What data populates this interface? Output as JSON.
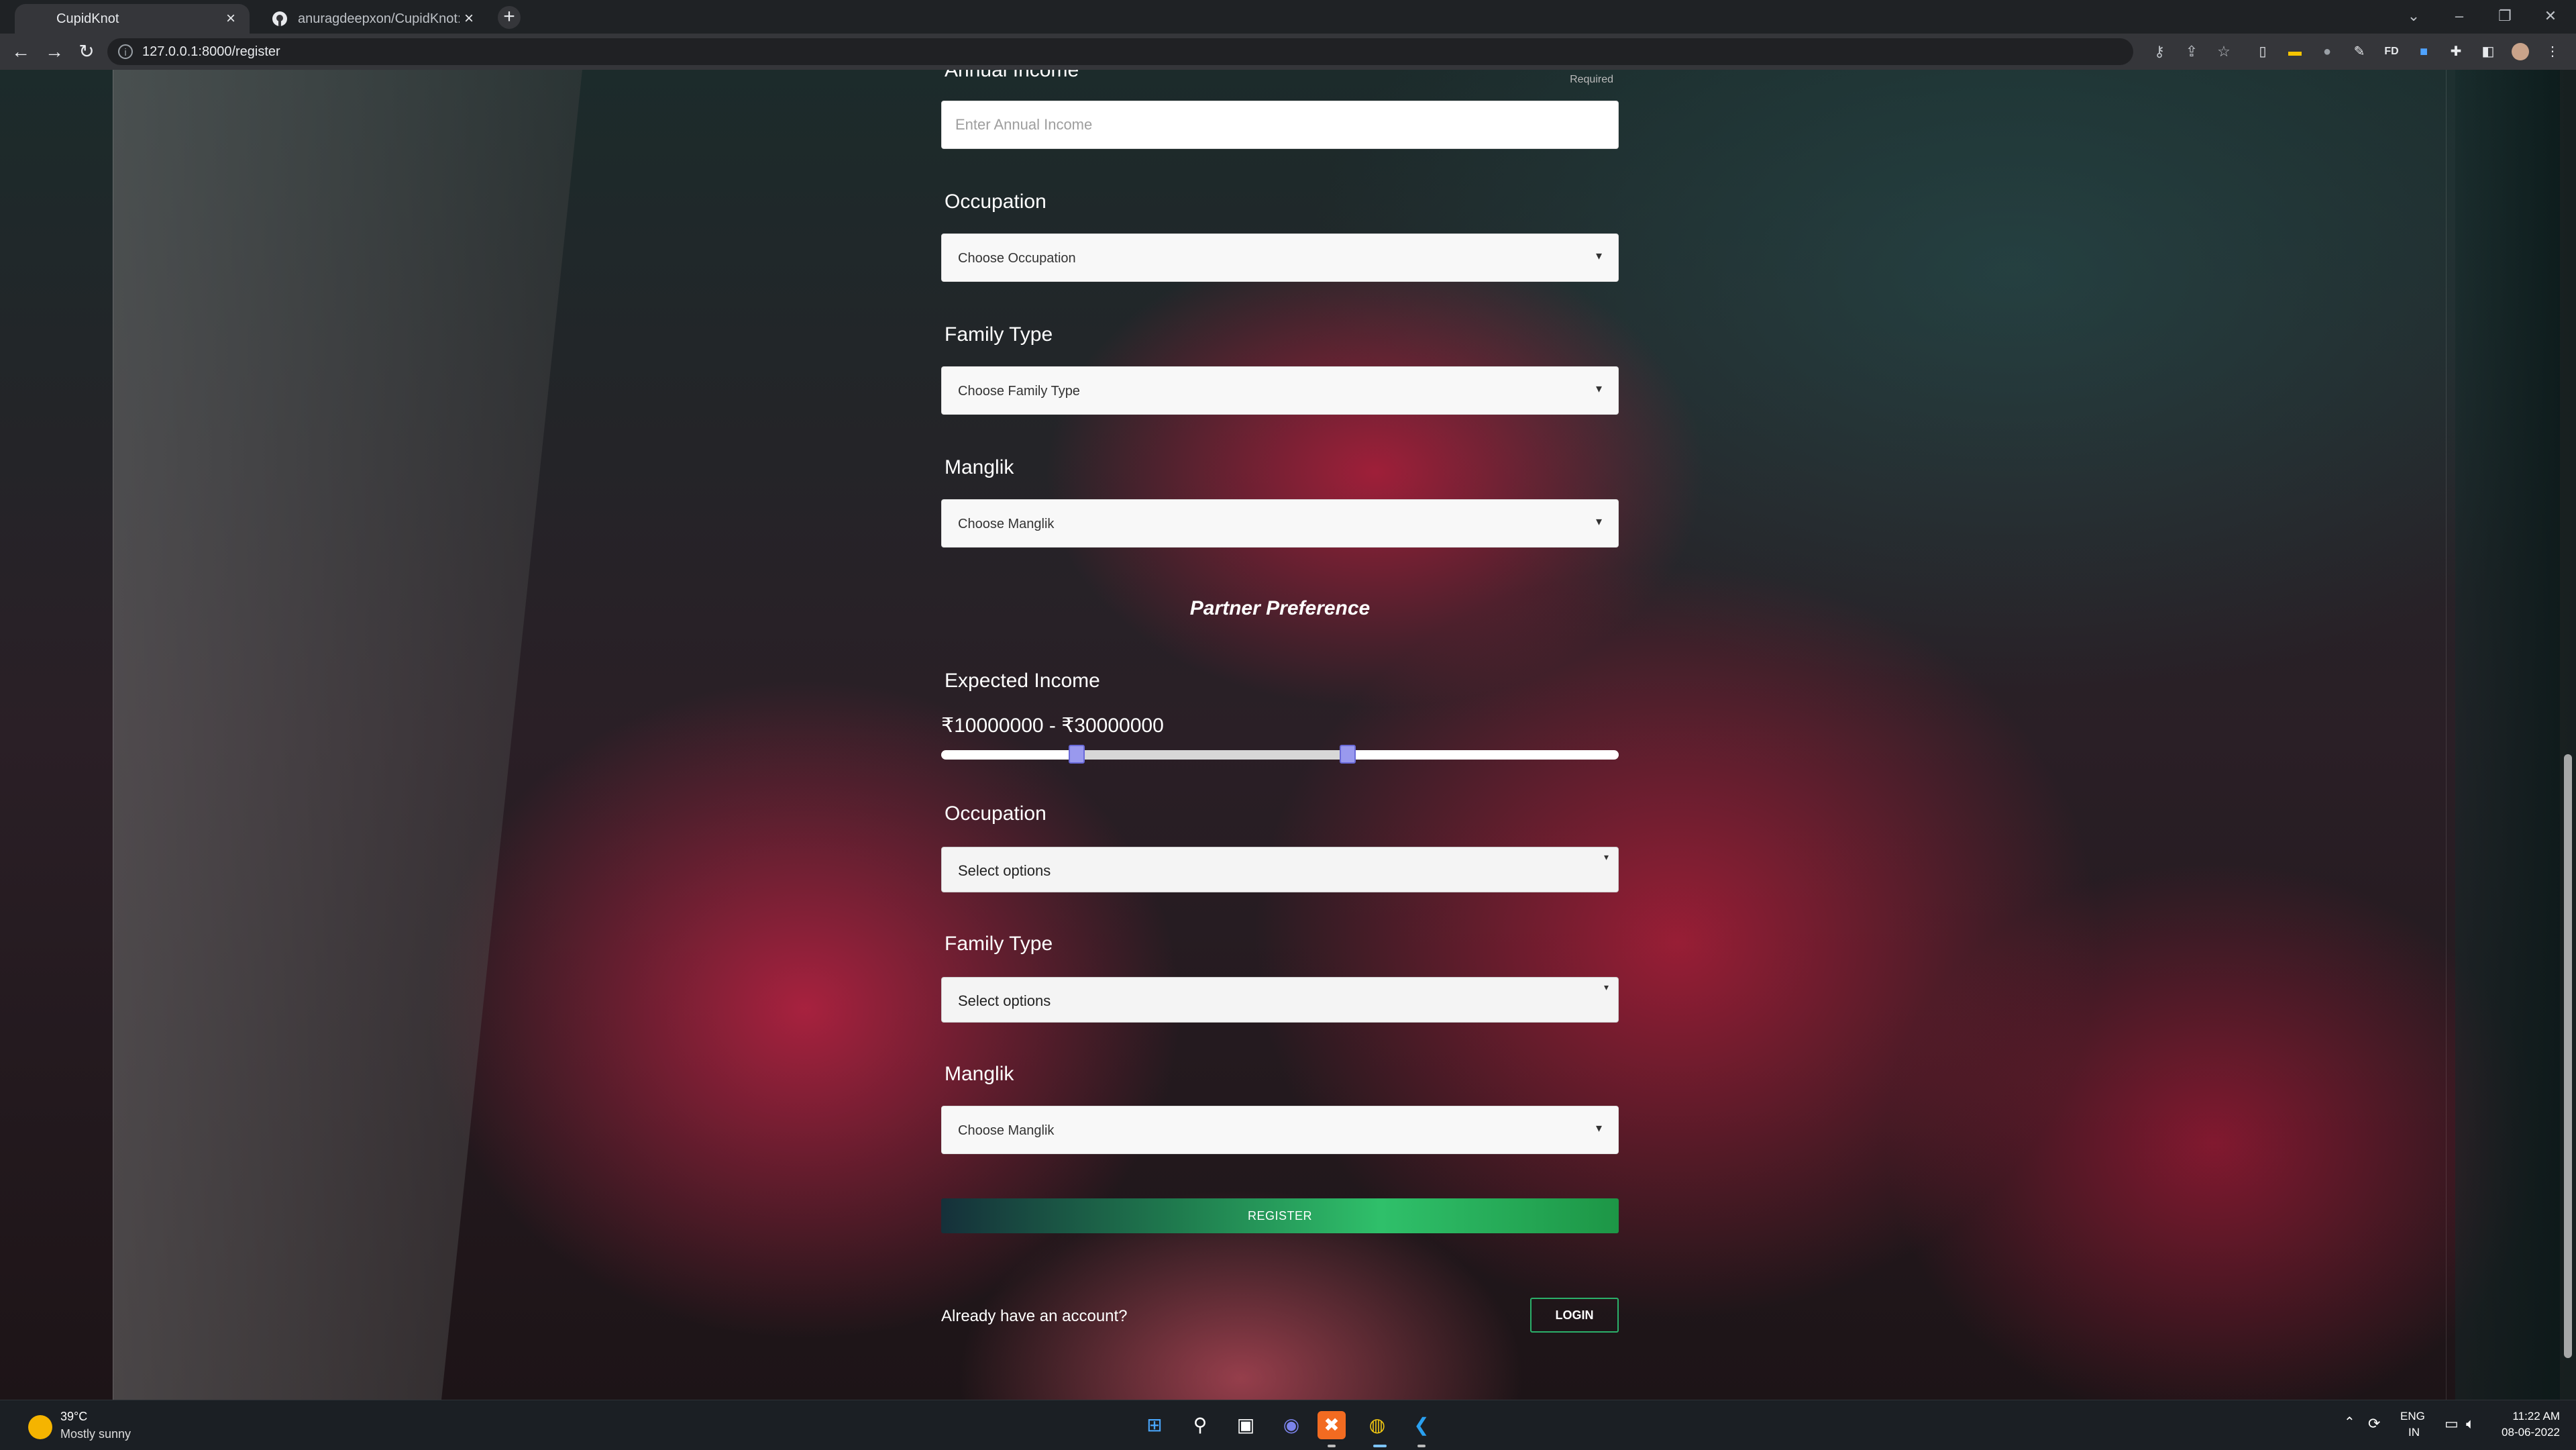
{
  "browser": {
    "tabs": [
      {
        "title": "CupidKnot",
        "active": true
      },
      {
        "title": "anuragdeepxon/CupidKnot: Cup",
        "active": false
      }
    ],
    "new_tab": "+",
    "url": "127.0.0.1:8000/register"
  },
  "form": {
    "annual_income": {
      "label": "Annual Income",
      "required": "Required",
      "placeholder": "Enter Annual Income"
    },
    "occupation": {
      "label": "Occupation",
      "value": "Choose Occupation"
    },
    "family_type": {
      "label": "Family Type",
      "value": "Choose Family Type"
    },
    "manglik": {
      "label": "Manglik",
      "value": "Choose Manglik"
    },
    "partner_preference": {
      "title": "Partner Preference",
      "expected_income": {
        "label": "Expected Income",
        "range_text": "₹10000000 - ₹30000000",
        "min": 10000000,
        "max": 30000000
      },
      "occupation": {
        "label": "Occupation",
        "value": "Select options"
      },
      "family_type": {
        "label": "Family Type",
        "value": "Select options"
      },
      "manglik": {
        "label": "Manglik",
        "value": "Choose Manglik"
      }
    },
    "register_label": "REGISTER",
    "already_text": "Already have an account?",
    "login_label": "LOGIN"
  },
  "taskbar": {
    "weather": {
      "temp": "39°C",
      "desc": "Mostly sunny"
    },
    "tray": {
      "lang": "ENG",
      "region": "IN",
      "time": "11:22 AM",
      "date": "08-06-2022"
    }
  },
  "colors": {
    "accent": "#2fc06a",
    "slider_handle": "#9999ee",
    "tabbar": "#1f2225",
    "toolbar": "#35363a"
  }
}
